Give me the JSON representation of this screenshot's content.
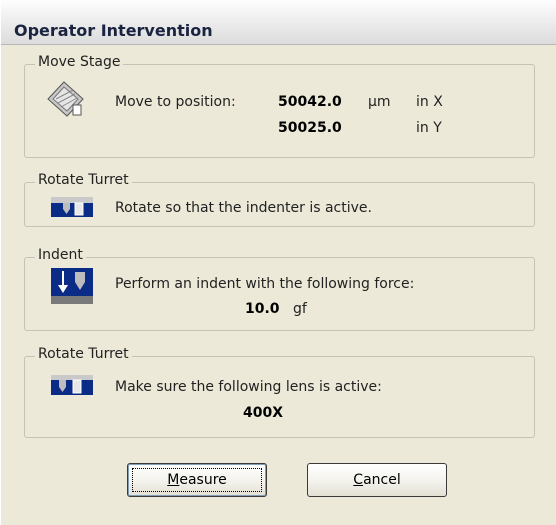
{
  "window": {
    "title": "Operator Intervention"
  },
  "move_stage": {
    "legend": "Move Stage",
    "instruction": "Move to position:",
    "x_value": "50042.0",
    "y_value": "50025.0",
    "unit": "µm",
    "x_axis_label": "in X",
    "y_axis_label": "in Y",
    "icon": "stage-icon"
  },
  "rotate_turret_1": {
    "legend": "Rotate Turret",
    "instruction": "Rotate so that the indenter is active.",
    "icon": "turret-indenter-icon"
  },
  "indent": {
    "legend": "Indent",
    "instruction": "Perform an indent with the following force:",
    "force_value": "10.0",
    "force_unit": "gf",
    "icon": "indent-icon"
  },
  "rotate_turret_2": {
    "legend": "Rotate Turret",
    "instruction": "Make sure the following lens is active:",
    "lens_value": "400X",
    "icon": "turret-lens-icon"
  },
  "buttons": {
    "measure_prefix": "",
    "measure_mnemonic": "M",
    "measure_rest": "easure",
    "cancel_prefix": "",
    "cancel_mnemonic": "C",
    "cancel_rest": "ancel"
  }
}
